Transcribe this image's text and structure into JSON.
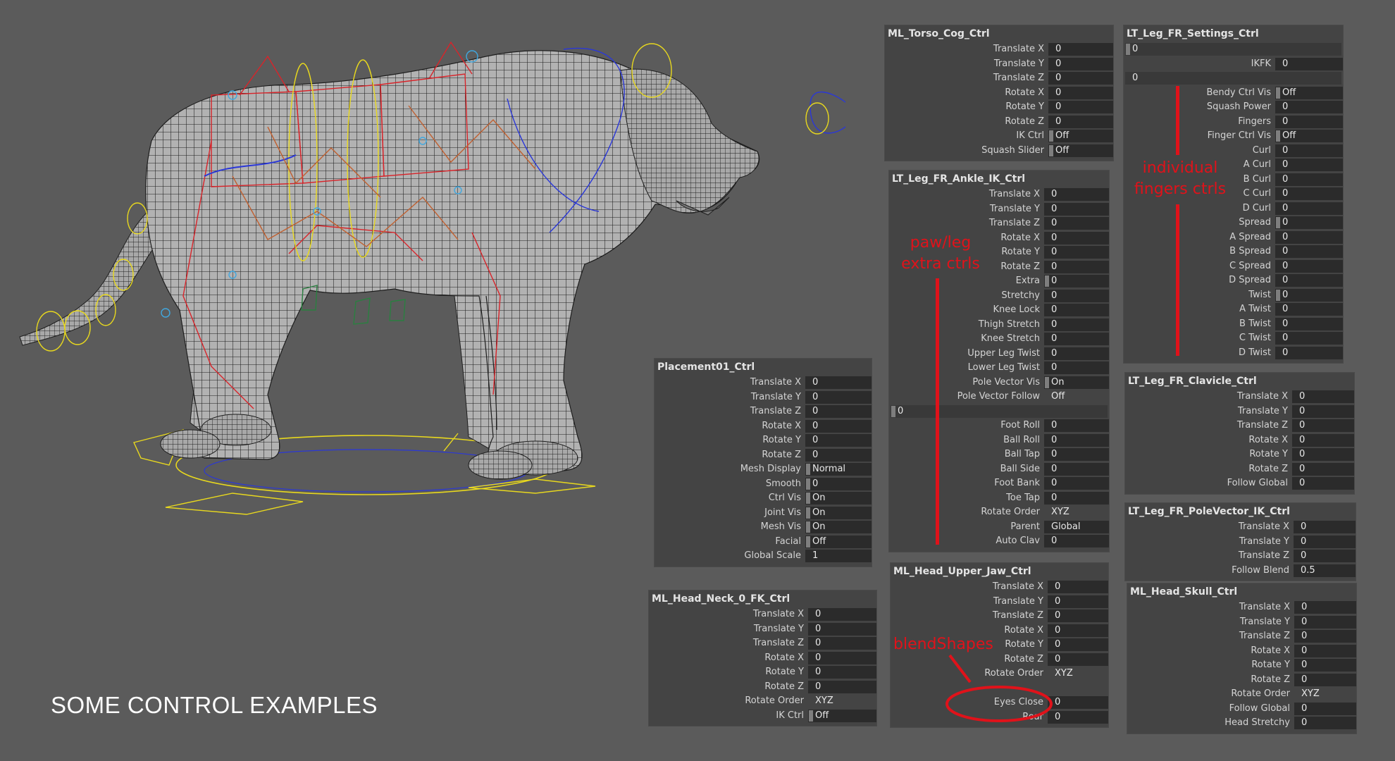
{
  "caption": "SOME CONTROL EXAMPLES",
  "annotations": {
    "paw_leg": [
      "paw/leg",
      "extra ctrls"
    ],
    "fingers": [
      "individual",
      "fingers ctrls"
    ],
    "blendshapes": "blendShapes"
  },
  "colors": {
    "background": "#5b5b5b",
    "panel": "#444444",
    "field": "#2b2b2b",
    "annotation": "#e0121a",
    "wire": "#1e1e1e",
    "mesh": "#b4b4b4",
    "ctrl_red": "#d8242a",
    "ctrl_yellow": "#e8d81e",
    "ctrl_blue": "#2a37d8",
    "ctrl_cyan": "#40a8e0",
    "ctrl_orange": "#c06030",
    "ctrl_green": "#2a8040"
  },
  "panels": [
    {
      "id": "torso",
      "title": "ML_Torso_Cog_Ctrl",
      "rows": [
        {
          "label": "Translate X",
          "value": "0"
        },
        {
          "label": "Translate Y",
          "value": "0"
        },
        {
          "label": "Translate Z",
          "value": "0"
        },
        {
          "label": "Rotate X",
          "value": "0"
        },
        {
          "label": "Rotate Y",
          "value": "0"
        },
        {
          "label": "Rotate Z",
          "value": "0"
        },
        {
          "label": "IK Ctrl",
          "value": "Off",
          "slider": true
        },
        {
          "label": "Squash Slider",
          "value": "Off",
          "slider": true
        }
      ]
    },
    {
      "id": "settings",
      "title": "LT_Leg_FR_Settings_Ctrl",
      "rows": [
        {
          "label": "",
          "value": "0",
          "slider": true,
          "blank": true
        },
        {
          "label": "IKFK",
          "value": "0"
        },
        {
          "label": "",
          "value": "0",
          "blank": true
        },
        {
          "label": "Bendy Ctrl Vis",
          "value": "Off",
          "slider": true
        },
        {
          "label": "Squash Power",
          "value": "0"
        },
        {
          "label": "Fingers",
          "value": "0"
        },
        {
          "label": "Finger Ctrl Vis",
          "value": "Off",
          "slider": true
        },
        {
          "label": "Curl",
          "value": "0"
        },
        {
          "label": "A Curl",
          "value": "0"
        },
        {
          "label": "B Curl",
          "value": "0"
        },
        {
          "label": "C Curl",
          "value": "0"
        },
        {
          "label": "D Curl",
          "value": "0"
        },
        {
          "label": "Spread",
          "value": "0",
          "slider": true
        },
        {
          "label": "A Spread",
          "value": "0"
        },
        {
          "label": "B Spread",
          "value": "0"
        },
        {
          "label": "C Spread",
          "value": "0"
        },
        {
          "label": "D Spread",
          "value": "0"
        },
        {
          "label": "Twist",
          "value": "0",
          "slider": true
        },
        {
          "label": "A Twist",
          "value": "0"
        },
        {
          "label": "B Twist",
          "value": "0"
        },
        {
          "label": "C Twist",
          "value": "0"
        },
        {
          "label": "D Twist",
          "value": "0"
        }
      ]
    },
    {
      "id": "ankle",
      "title": "LT_Leg_FR_Ankle_IK_Ctrl",
      "rows": [
        {
          "label": "Translate X",
          "value": "0"
        },
        {
          "label": "Translate Y",
          "value": "0"
        },
        {
          "label": "Translate Z",
          "value": "0"
        },
        {
          "label": "Rotate X",
          "value": "0"
        },
        {
          "label": "Rotate Y",
          "value": "0"
        },
        {
          "label": "Rotate Z",
          "value": "0"
        },
        {
          "label": "Extra",
          "value": "0",
          "slider": true
        },
        {
          "label": "Stretchy",
          "value": "0"
        },
        {
          "label": "Knee Lock",
          "value": "0"
        },
        {
          "label": "Thigh Stretch",
          "value": "0"
        },
        {
          "label": "Knee Stretch",
          "value": "0"
        },
        {
          "label": "Upper Leg Twist",
          "value": "0"
        },
        {
          "label": "Lower Leg Twist",
          "value": "0"
        },
        {
          "label": "Pole Vector Vis",
          "value": "On",
          "slider": true
        },
        {
          "label": "Pole Vector Follow",
          "value": "Off",
          "plain": true
        },
        {
          "label": "",
          "value": "0",
          "slider": true,
          "blank": true
        },
        {
          "label": "Foot Roll",
          "value": "0"
        },
        {
          "label": "Ball Roll",
          "value": "0"
        },
        {
          "label": "Ball Tap",
          "value": "0"
        },
        {
          "label": "Ball Side",
          "value": "0"
        },
        {
          "label": "Foot Bank",
          "value": "0"
        },
        {
          "label": "Toe Tap",
          "value": "0"
        },
        {
          "label": "Rotate Order",
          "value": "XYZ",
          "plain": true
        },
        {
          "label": "Parent",
          "value": "Global"
        },
        {
          "label": "Auto Clav",
          "value": "0"
        }
      ]
    },
    {
      "id": "placement",
      "title": "Placement01_Ctrl",
      "rows": [
        {
          "label": "Translate X",
          "value": "0"
        },
        {
          "label": "Translate Y",
          "value": "0"
        },
        {
          "label": "Translate Z",
          "value": "0"
        },
        {
          "label": "Rotate X",
          "value": "0"
        },
        {
          "label": "Rotate Y",
          "value": "0"
        },
        {
          "label": "Rotate Z",
          "value": "0"
        },
        {
          "label": "Mesh Display",
          "value": "Normal",
          "slider": true
        },
        {
          "label": "Smooth",
          "value": "0",
          "slider": true
        },
        {
          "label": "Ctrl Vis",
          "value": "On",
          "slider": true
        },
        {
          "label": "Joint Vis",
          "value": "On",
          "slider": true
        },
        {
          "label": "Mesh Vis",
          "value": "On",
          "slider": true
        },
        {
          "label": "Facial",
          "value": "Off",
          "slider": true
        },
        {
          "label": "Global Scale",
          "value": "1"
        }
      ]
    },
    {
      "id": "clavicle",
      "title": "LT_Leg_FR_Clavicle_Ctrl",
      "rows": [
        {
          "label": "Translate X",
          "value": "0"
        },
        {
          "label": "Translate Y",
          "value": "0"
        },
        {
          "label": "Translate Z",
          "value": "0"
        },
        {
          "label": "Rotate X",
          "value": "0"
        },
        {
          "label": "Rotate Y",
          "value": "0"
        },
        {
          "label": "Rotate Z",
          "value": "0"
        },
        {
          "label": "Follow Global",
          "value": "0"
        }
      ]
    },
    {
      "id": "polevector",
      "title": "LT_Leg_FR_PoleVector_IK_Ctrl",
      "rows": [
        {
          "label": "Translate X",
          "value": "0"
        },
        {
          "label": "Translate Y",
          "value": "0"
        },
        {
          "label": "Translate Z",
          "value": "0"
        },
        {
          "label": "Follow Blend",
          "value": "0.5"
        }
      ]
    },
    {
      "id": "upperjaw",
      "title": "ML_Head_Upper_Jaw_Ctrl",
      "rows": [
        {
          "label": "Translate X",
          "value": "0"
        },
        {
          "label": "Translate Y",
          "value": "0"
        },
        {
          "label": "Translate Z",
          "value": "0"
        },
        {
          "label": "Rotate X",
          "value": "0"
        },
        {
          "label": "Rotate Y",
          "value": "0"
        },
        {
          "label": "Rotate Z",
          "value": "0"
        },
        {
          "label": "Rotate Order",
          "value": "XYZ",
          "plain": true
        },
        {
          "label": "",
          "value": "",
          "gap": true
        },
        {
          "label": "Eyes Close",
          "value": "0"
        },
        {
          "label": "Roar",
          "value": "0"
        }
      ]
    },
    {
      "id": "neck",
      "title": "ML_Head_Neck_0_FK_Ctrl",
      "rows": [
        {
          "label": "Translate X",
          "value": "0"
        },
        {
          "label": "Translate Y",
          "value": "0"
        },
        {
          "label": "Translate Z",
          "value": "0"
        },
        {
          "label": "Rotate X",
          "value": "0"
        },
        {
          "label": "Rotate Y",
          "value": "0"
        },
        {
          "label": "Rotate Z",
          "value": "0"
        },
        {
          "label": "Rotate Order",
          "value": "XYZ",
          "plain": true
        },
        {
          "label": "IK Ctrl",
          "value": "Off",
          "slider": true
        }
      ]
    },
    {
      "id": "skull",
      "title": "ML_Head_Skull_Ctrl",
      "rows": [
        {
          "label": "Translate X",
          "value": "0"
        },
        {
          "label": "Translate Y",
          "value": "0"
        },
        {
          "label": "Translate Z",
          "value": "0"
        },
        {
          "label": "Rotate X",
          "value": "0"
        },
        {
          "label": "Rotate Y",
          "value": "0"
        },
        {
          "label": "Rotate Z",
          "value": "0"
        },
        {
          "label": "Rotate Order",
          "value": "XYZ",
          "plain": true
        },
        {
          "label": "Follow Global",
          "value": "0"
        },
        {
          "label": "Head Stretchy",
          "value": "0"
        }
      ]
    }
  ]
}
